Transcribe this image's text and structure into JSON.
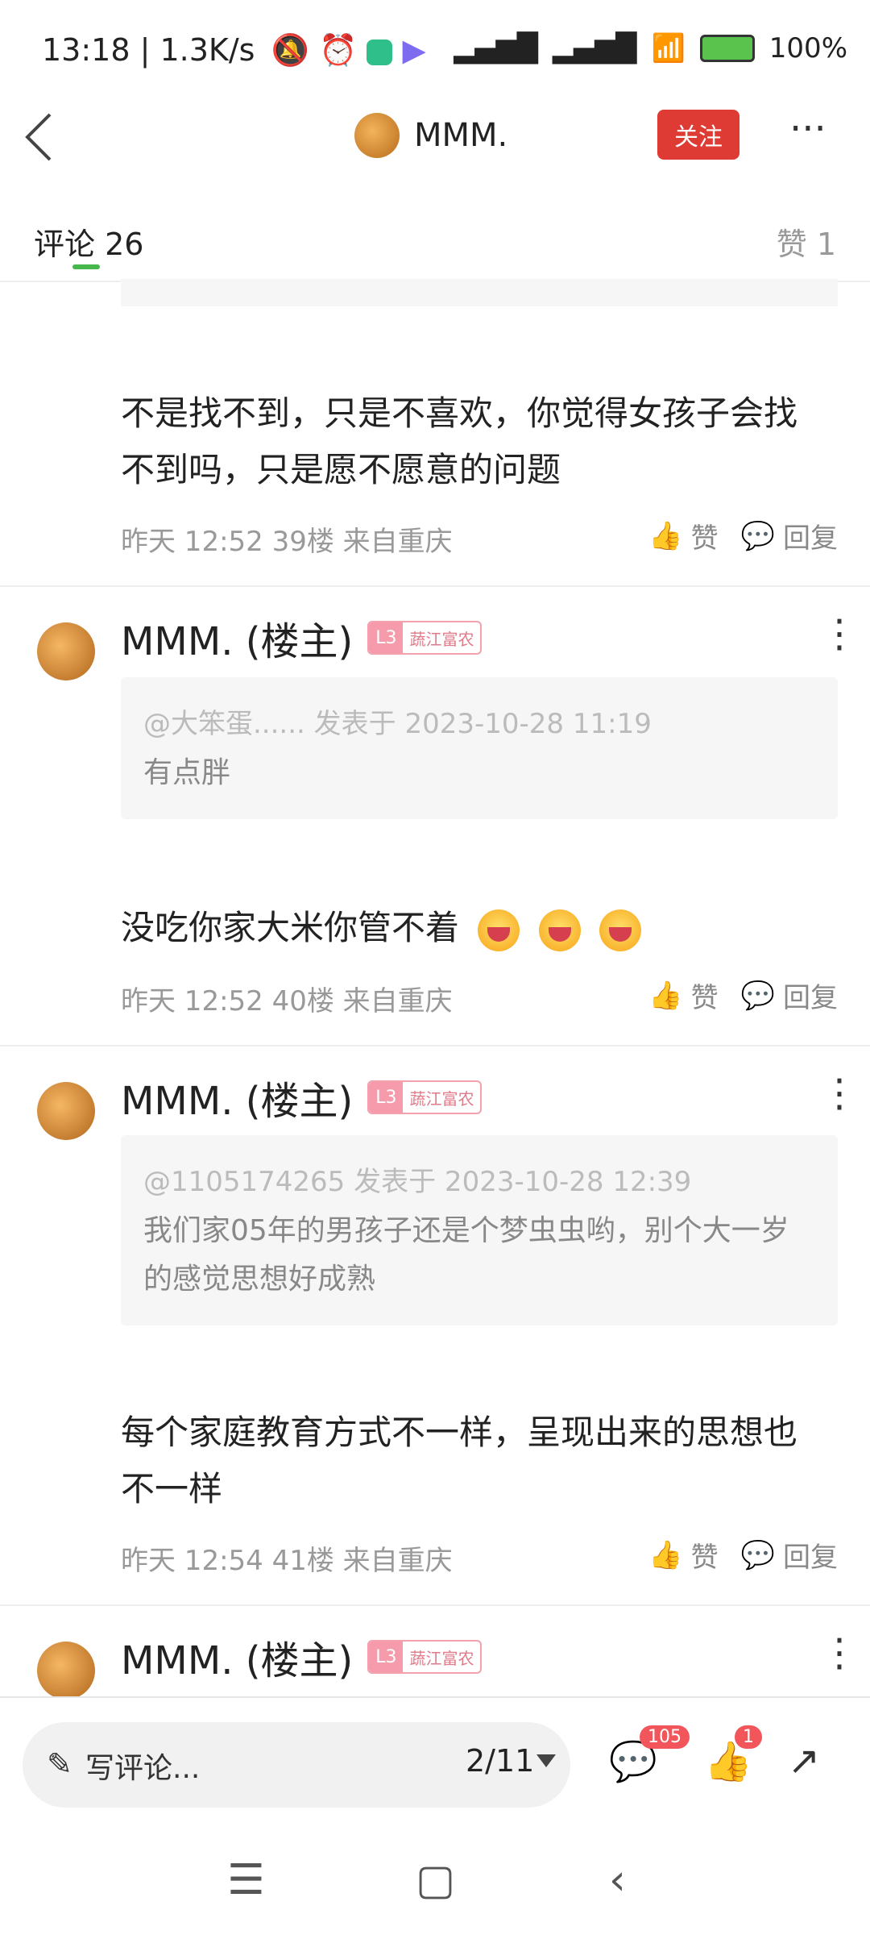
{
  "status_bar": {
    "time": "13:18",
    "speed": "1.3K/s",
    "battery": "100%",
    "icons": [
      "mute-icon",
      "alarm-icon",
      "app-icon",
      "play-icon",
      "signal-icon",
      "signal-icon",
      "wifi-icon",
      "battery-icon"
    ]
  },
  "header": {
    "title": "MMM.",
    "follow_label": "关注",
    "more": "···"
  },
  "tabs": {
    "comments_label": "评论",
    "comments_count": "26",
    "likes_label": "赞 1"
  },
  "comments": [
    {
      "text": "不是找不到，只是不喜欢，你觉得女孩子会找不到吗，只是愿不愿意的问题",
      "meta": "昨天 12:52  39楼  来自重庆",
      "like": "赞",
      "reply": "回复"
    },
    {
      "author": "MMM. (楼主)",
      "badge_level": "L3",
      "badge_title": "蔬江富农",
      "quote_ref": "@大笨蛋...... 发表于 2023-10-28 11:19",
      "quote_text": "有点胖",
      "text": "没吃你家大米你管不着",
      "meta": "昨天 12:52  40楼  来自重庆",
      "like": "赞",
      "reply": "回复"
    },
    {
      "author": "MMM. (楼主)",
      "badge_level": "L3",
      "badge_title": "蔬江富农",
      "quote_ref": "@1105174265 发表于 2023-10-28 12:39",
      "quote_text": "我们家05年的男孩子还是个梦虫虫哟，别个大一岁的感觉思想好成熟",
      "text": "每个家庭教育方式不一样，呈现出来的思想也不一样",
      "meta": "昨天 12:54  41楼  来自重庆",
      "like": "赞",
      "reply": "回复"
    },
    {
      "author": "MMM. (楼主)",
      "badge_level": "L3",
      "badge_title": "蔬江富农"
    }
  ],
  "bottom_bar": {
    "write_placeholder": "写评论...",
    "page_indicator": "2/11",
    "comment_count": "105",
    "like_count": "1"
  }
}
